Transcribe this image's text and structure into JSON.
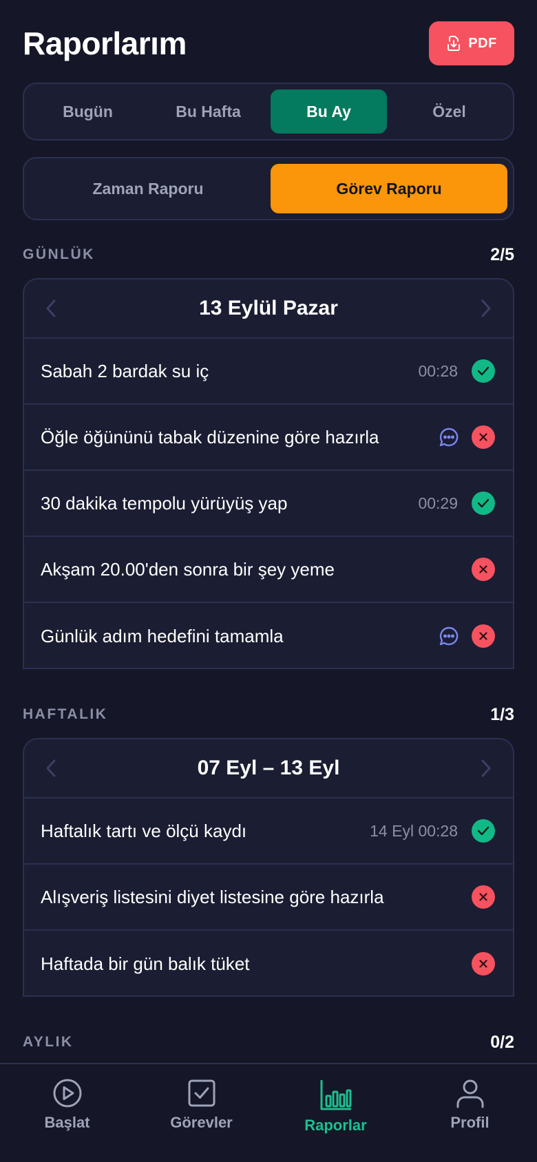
{
  "header": {
    "title": "Raporlarım",
    "pdf_label": "PDF"
  },
  "period_tabs": [
    {
      "label": "Bugün",
      "active": false
    },
    {
      "label": "Bu Hafta",
      "active": false
    },
    {
      "label": "Bu Ay",
      "active": true
    },
    {
      "label": "Özel",
      "active": false
    }
  ],
  "report_tabs": [
    {
      "label": "Zaman Raporu",
      "active": false
    },
    {
      "label": "Görev Raporu",
      "active": true
    }
  ],
  "sections": {
    "daily": {
      "title": "GÜNLÜK",
      "count": "2/5",
      "date": "13 Eylül Pazar",
      "rows": [
        {
          "task": "Sabah 2 bardak su iç",
          "time": "00:28",
          "status": "done"
        },
        {
          "task": "Öğle öğününü tabak düzenine göre hazırla",
          "comment": true,
          "status": "fail"
        },
        {
          "task": "30 dakika tempolu yürüyüş yap",
          "time": "00:29",
          "status": "done"
        },
        {
          "task": "Akşam 20.00'den sonra bir şey yeme",
          "status": "fail"
        },
        {
          "task": "Günlük adım hedefini tamamla",
          "comment": true,
          "status": "fail"
        }
      ]
    },
    "weekly": {
      "title": "HAFTALIK",
      "count": "1/3",
      "date": "07 Eyl – 13 Eyl",
      "rows": [
        {
          "task": "Haftalık tartı ve ölçü kaydı",
          "time": "14 Eyl 00:28",
          "status": "done"
        },
        {
          "task": "Alışveriş listesini diyet listesine göre hazırla",
          "status": "fail"
        },
        {
          "task": "Haftada bir gün balık tüket",
          "status": "fail"
        }
      ]
    },
    "monthly": {
      "title": "AYLIK",
      "count": "0/2"
    }
  },
  "nav": [
    {
      "label": "Başlat",
      "icon": "play-icon",
      "active": false
    },
    {
      "label": "Görevler",
      "icon": "checkbox-icon",
      "active": false
    },
    {
      "label": "Raporlar",
      "icon": "bar-chart-icon",
      "active": true
    },
    {
      "label": "Profil",
      "icon": "user-icon",
      "active": false
    }
  ],
  "colors": {
    "background": "#151728",
    "card": "#1b1d32",
    "border": "#2c3050",
    "accent_green": "#047a5e",
    "accent_orange": "#fb950a",
    "danger": "#f7525f",
    "success": "#12b886",
    "comment": "#7b86f0",
    "active_nav": "#1dbf8e"
  }
}
